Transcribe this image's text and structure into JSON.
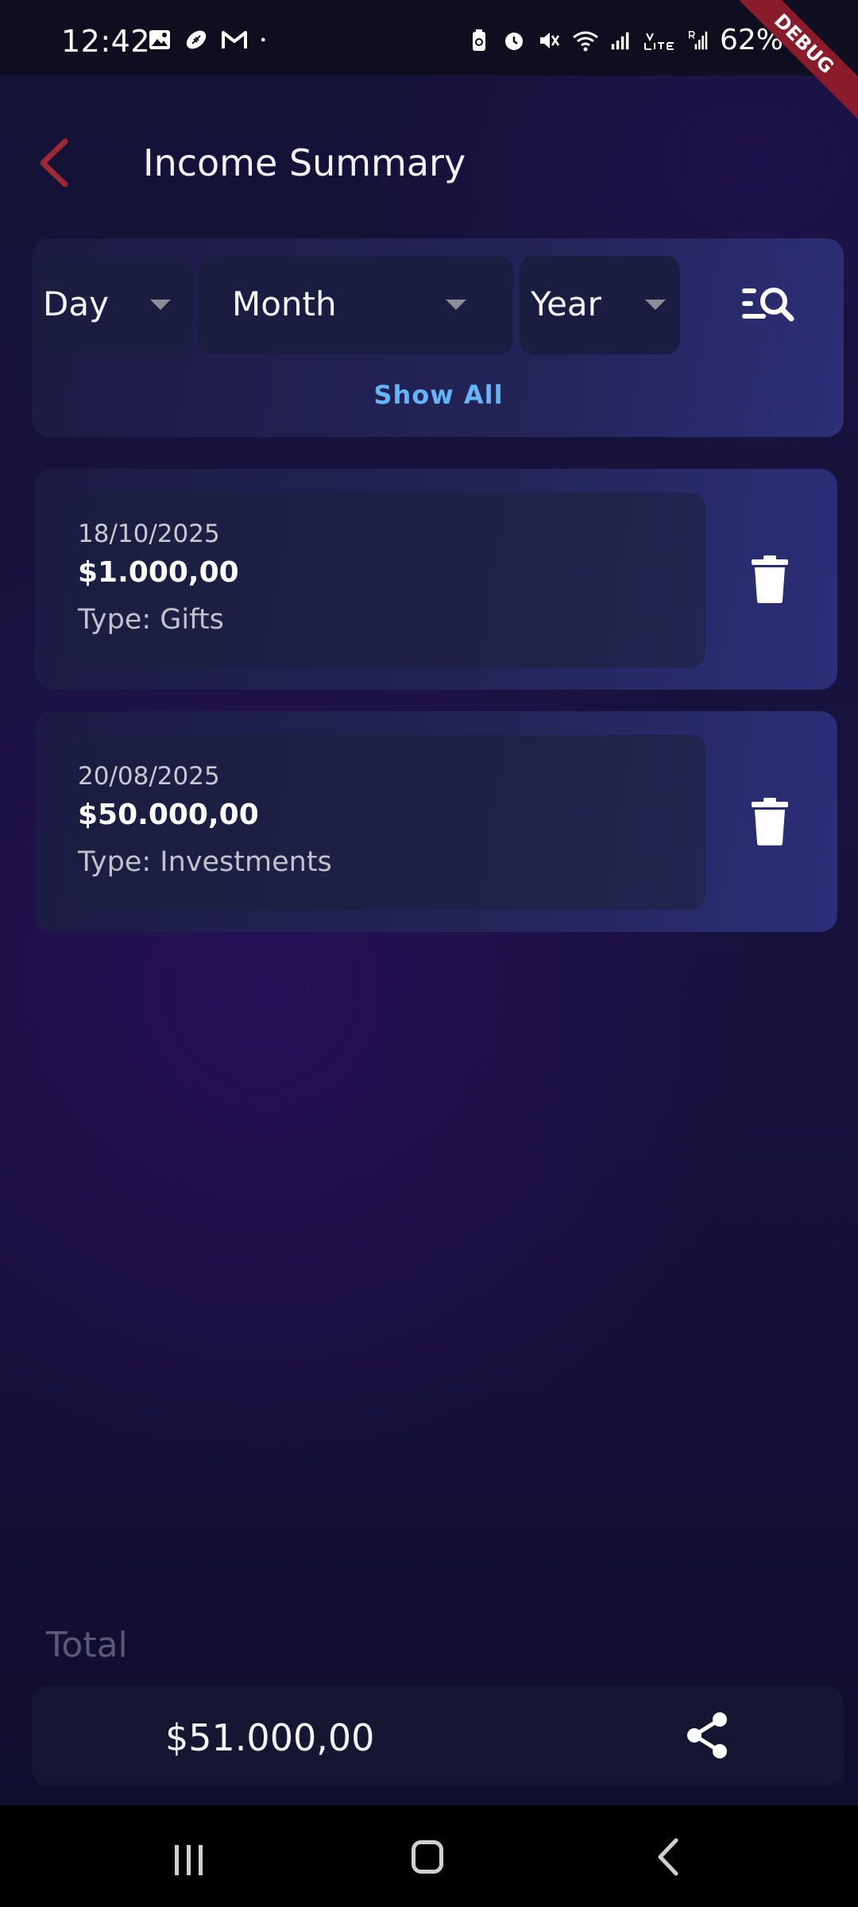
{
  "status_bar": {
    "time": "12:42",
    "battery": "62%",
    "debug_banner": "DEBUG",
    "left_icons": [
      "image-icon",
      "football-icon",
      "gmail-icon",
      "dot-icon"
    ],
    "right_icons": [
      "battery-saver-icon",
      "alarm-icon",
      "mute-icon",
      "wifi-icon",
      "signal-icon",
      "volte-icon",
      "signal-roaming-icon",
      "battery-icon"
    ]
  },
  "header": {
    "title": "Income Summary",
    "back_icon": "chevron-left-icon"
  },
  "filters": {
    "day_label": "Day",
    "month_label": "Month",
    "year_label": "Year",
    "search_icon": "filter-search-icon",
    "show_all": "Show All"
  },
  "entries": [
    {
      "date": "18/10/2025",
      "amount": "$1.000,00",
      "type": "Type: Gifts"
    },
    {
      "date": "20/08/2025",
      "amount": "$50.000,00",
      "type": "Type: Investments"
    }
  ],
  "total": {
    "label": "Total",
    "amount": "$51.000,00",
    "share_icon": "share-icon"
  },
  "colors": {
    "accent_link": "#64b4f6",
    "back_chevron": "#9b2a35",
    "debug_ribbon": "#8a1b2b",
    "background": "#17123e"
  },
  "nav_bar": {
    "icons": [
      "recents-icon",
      "home-icon",
      "back-icon"
    ]
  }
}
